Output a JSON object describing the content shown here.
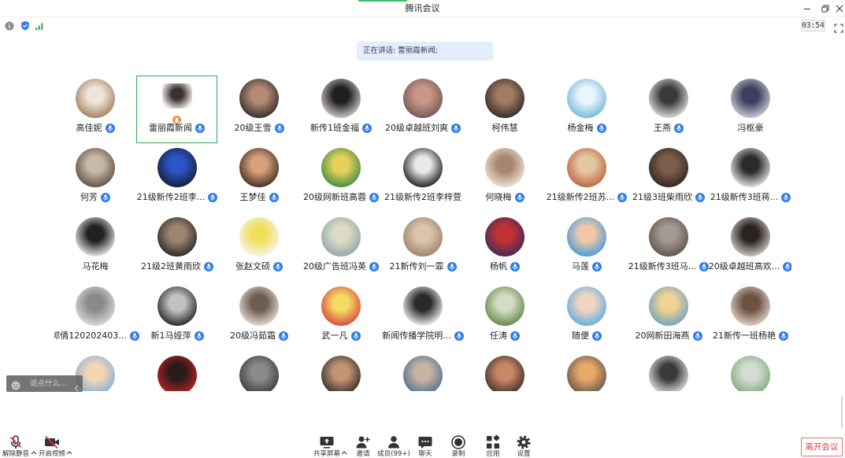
{
  "window": {
    "title": "腾讯会议"
  },
  "status": {
    "timer": "03:54"
  },
  "speaking_banner": {
    "text": "正在讲话: 雷丽霞新闻;"
  },
  "participants": [
    {
      "name": "高佳妮",
      "mic_icon": true,
      "avatar_colors": [
        "#f1e4d6",
        "#9c7b63"
      ]
    },
    {
      "name": "雷丽霞新闻",
      "mic_icon": true,
      "speaking": true,
      "host_badge": true,
      "avatar_colors": [
        "#3a3030",
        "#f7f5f3"
      ]
    },
    {
      "name": "20级王雪",
      "mic_icon": true,
      "avatar_colors": [
        "#b58a72",
        "#2e2a2a"
      ]
    },
    {
      "name": "新传1班金福",
      "mic_icon": true,
      "avatar_colors": [
        "#1f1f1f",
        "#d8d2cf"
      ]
    },
    {
      "name": "20级卓越班刘爽",
      "mic_icon": true,
      "avatar_colors": [
        "#c9968a",
        "#6e5650"
      ]
    },
    {
      "name": "柯伟慧",
      "mic_icon": false,
      "avatar_colors": [
        "#a27c62",
        "#2f2626"
      ]
    },
    {
      "name": "杨金梅",
      "mic_icon": true,
      "avatar_colors": [
        "#eaf5fb",
        "#6eb6df"
      ]
    },
    {
      "name": "王燕",
      "mic_icon": true,
      "avatar_colors": [
        "#3a3a3a",
        "#e4e4e4"
      ]
    },
    {
      "name": "冯枢豪",
      "mic_icon": false,
      "avatar_colors": [
        "#3e3f5c",
        "#d3d3e0"
      ]
    },
    {
      "name": "何芳",
      "mic_icon": true,
      "avatar_colors": [
        "#c8b8a6",
        "#5c4b40"
      ]
    },
    {
      "name": "21级新传2班李...",
      "mic_icon": true,
      "avatar_colors": [
        "#2c56c4",
        "#151a33"
      ]
    },
    {
      "name": "王梦佳",
      "mic_icon": true,
      "avatar_colors": [
        "#d9a07c",
        "#3b2a20"
      ]
    },
    {
      "name": "20级网新班高蓉",
      "mic_icon": true,
      "avatar_colors": [
        "#e6cf5c",
        "#3d8a40"
      ]
    },
    {
      "name": "21级新传2班李梓萱",
      "mic_icon": false,
      "avatar_colors": [
        "#e8e8e8",
        "#161616"
      ]
    },
    {
      "name": "何晓梅",
      "mic_icon": true,
      "avatar_colors": [
        "#a8866e",
        "#f4e8dc"
      ]
    },
    {
      "name": "21级新传2班苏...",
      "mic_icon": true,
      "avatar_colors": [
        "#e6c6a4",
        "#b8623f"
      ]
    },
    {
      "name": "21级3班柴雨欣",
      "mic_icon": true,
      "avatar_colors": [
        "#7d5e4d",
        "#2f231d"
      ]
    },
    {
      "name": "21级新传3班蒋...",
      "mic_icon": true,
      "avatar_colors": [
        "#2a2a2a",
        "#f2ecec"
      ]
    },
    {
      "name": "马花梅",
      "mic_icon": false,
      "avatar_colors": [
        "#222222",
        "#f3f3f3"
      ]
    },
    {
      "name": "21级2班黄雨欣",
      "mic_icon": true,
      "avatar_colors": [
        "#a08472",
        "#262626"
      ]
    },
    {
      "name": "张赵文硕",
      "mic_icon": true,
      "avatar_colors": [
        "#f0df5e",
        "#f6f6f6"
      ]
    },
    {
      "name": "20级广告班冯英",
      "mic_icon": true,
      "avatar_colors": [
        "#dcdcc4",
        "#8ea4ac"
      ]
    },
    {
      "name": "21新传刘一霏",
      "mic_icon": true,
      "avatar_colors": [
        "#dcc4aa",
        "#9a826c"
      ]
    },
    {
      "name": "杨帆",
      "mic_icon": true,
      "avatar_colors": [
        "#c23232",
        "#3a2a5c"
      ]
    },
    {
      "name": "马莲",
      "mic_icon": true,
      "avatar_colors": [
        "#f2c6a6",
        "#3e9be0"
      ]
    },
    {
      "name": "21级新传3班马...",
      "mic_icon": true,
      "avatar_colors": [
        "#a49a92",
        "#5c524a"
      ]
    },
    {
      "name": "20级卓越班高欢...",
      "mic_icon": true,
      "avatar_colors": [
        "#2a2420",
        "#d9d1c9"
      ]
    },
    {
      "name": "郭倩120202403...",
      "mic_icon": true,
      "avatar_colors": [
        "#8a8a8a",
        "#dedede"
      ]
    },
    {
      "name": "新1马娅萍",
      "mic_icon": true,
      "avatar_colors": [
        "#c2c2c2",
        "#1e1e1e"
      ]
    },
    {
      "name": "20级冯茹霜",
      "mic_icon": true,
      "avatar_colors": [
        "#6c5c52",
        "#ebe3db"
      ]
    },
    {
      "name": "武一凡",
      "mic_icon": true,
      "avatar_colors": [
        "#f2dc62",
        "#d94040"
      ]
    },
    {
      "name": "新闻传播学院明...",
      "mic_icon": true,
      "avatar_colors": [
        "#2a2a2a",
        "#fbfbfb"
      ]
    },
    {
      "name": "任涛",
      "mic_icon": true,
      "avatar_colors": [
        "#d4dcc4",
        "#5f8444"
      ]
    },
    {
      "name": "随便",
      "mic_icon": true,
      "avatar_colors": [
        "#f2d4c2",
        "#58ace0"
      ]
    },
    {
      "name": "20网新田海燕",
      "mic_icon": true,
      "avatar_colors": [
        "#f2d292",
        "#6aa2c2"
      ]
    },
    {
      "name": "21新传一班杨艳",
      "mic_icon": true,
      "avatar_colors": [
        "#6c5242",
        "#e6d8d0"
      ]
    },
    {
      "avatar_colors": [
        "#f4d6b4",
        "#7fb0d8"
      ]
    },
    {
      "avatar_colors": [
        "#2a1a1a",
        "#c02424"
      ]
    },
    {
      "avatar_colors": [
        "#8a8a8a",
        "#3a3a3a"
      ]
    },
    {
      "avatar_colors": [
        "#c49474",
        "#2b2b2b"
      ]
    },
    {
      "avatar_colors": [
        "#c6b4a4",
        "#4e6e8e"
      ]
    },
    {
      "avatar_colors": [
        "#c88866",
        "#3a2a2a"
      ]
    },
    {
      "avatar_colors": [
        "#e8a866",
        "#5e544c"
      ]
    },
    {
      "avatar_colors": [
        "#3a3a3a",
        "#ececec"
      ]
    },
    {
      "avatar_colors": [
        "#d4dcd4",
        "#7fa877"
      ]
    }
  ],
  "chat_input": {
    "placeholder": "说点什么..."
  },
  "toolbar": {
    "unmute": "解除静音",
    "start_video": "开启视频",
    "share_screen": "共享屏幕",
    "invite": "邀请",
    "members": "成员(99+)",
    "chat": "聊天",
    "record": "录制",
    "apps": "应用",
    "settings": "设置",
    "leave": "离开会议"
  },
  "icons": {
    "window": [
      "minimize-icon",
      "restore-icon",
      "close-icon"
    ],
    "status": [
      "info-icon",
      "shield-icon",
      "signal-icon",
      "fullscreen-icon"
    ],
    "toolbar": [
      "mic-off-icon",
      "camera-off-icon",
      "share-screen-icon",
      "invite-icon",
      "members-icon",
      "chat-icon",
      "record-icon",
      "apps-icon",
      "settings-icon"
    ]
  },
  "colors": {
    "mic_badge": "#2f7bea",
    "speaking_border": "#2fa85c",
    "leave": "#e23b40",
    "muted_slash": "#e0393e",
    "banner_bg": "#e4edfc"
  }
}
